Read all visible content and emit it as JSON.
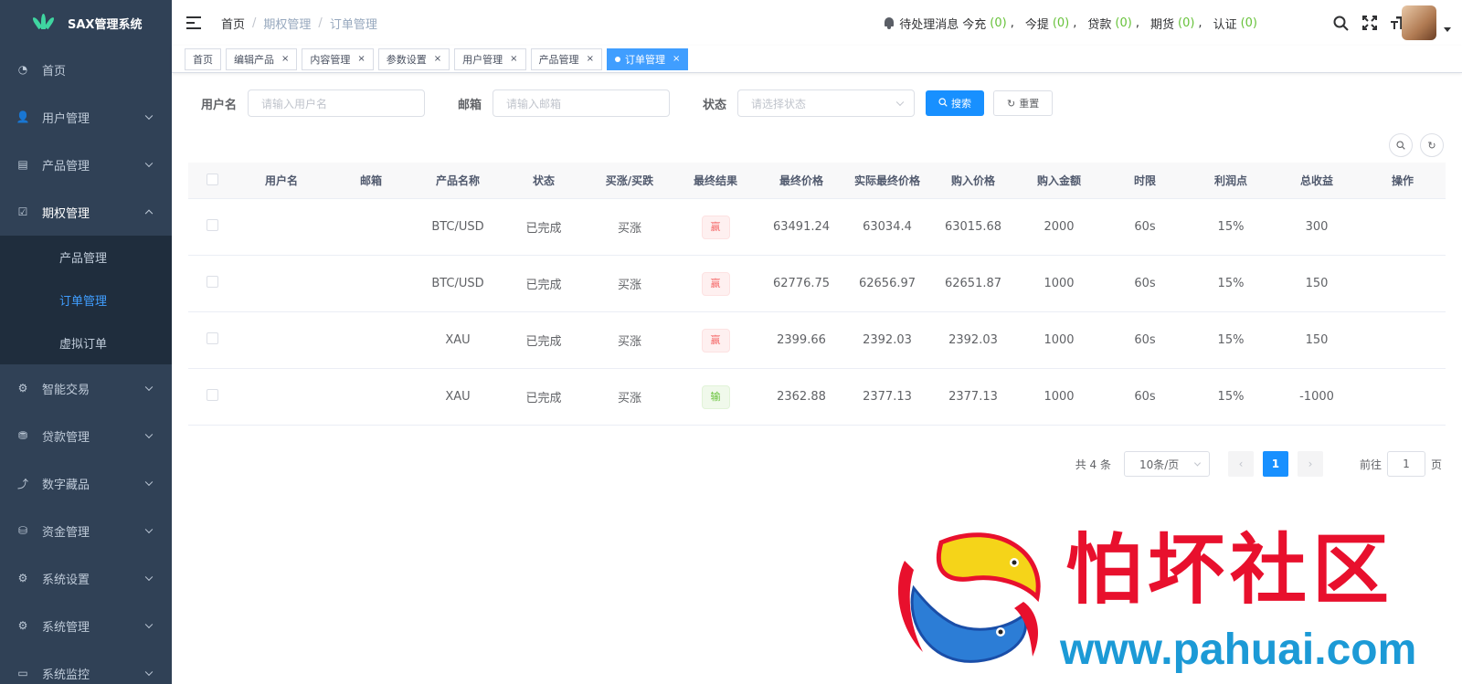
{
  "app": {
    "title": "SAX管理系统"
  },
  "sidebar": {
    "items": [
      {
        "label": "首页",
        "icon": "dashboard-icon"
      },
      {
        "label": "用户管理",
        "icon": "user-icon"
      },
      {
        "label": "产品管理",
        "icon": "document-icon"
      },
      {
        "label": "期权管理",
        "icon": "checkbox-icon"
      },
      {
        "label": "智能交易",
        "icon": "gear-icon"
      },
      {
        "label": "贷款管理",
        "icon": "stack-icon"
      },
      {
        "label": "数字藏品",
        "icon": "chart-icon"
      },
      {
        "label": "资金管理",
        "icon": "money-icon"
      },
      {
        "label": "系统设置",
        "icon": "gear-icon"
      },
      {
        "label": "系统管理",
        "icon": "gear-icon"
      },
      {
        "label": "系统监控",
        "icon": "monitor-icon"
      }
    ],
    "submenu": [
      {
        "label": "产品管理"
      },
      {
        "label": "订单管理"
      },
      {
        "label": "虚拟订单"
      }
    ]
  },
  "header": {
    "breadcrumb": [
      "首页",
      "期权管理",
      "订单管理"
    ],
    "notify": {
      "label": "待处理消息",
      "items": [
        {
          "label": "今充",
          "count": "(0)"
        },
        {
          "label": "今提",
          "count": "(0)"
        },
        {
          "label": "贷款",
          "count": "(0)"
        },
        {
          "label": "期货",
          "count": "(0)"
        },
        {
          "label": "认证",
          "count": "(0)"
        }
      ]
    }
  },
  "tags": [
    "首页",
    "编辑产品",
    "内容管理",
    "参数设置",
    "用户管理",
    "产品管理",
    "订单管理"
  ],
  "search": {
    "username_label": "用户名",
    "username_placeholder": "请输入用户名",
    "email_label": "邮箱",
    "email_placeholder": "请输入邮箱",
    "status_label": "状态",
    "status_placeholder": "请选择状态",
    "search_btn": "搜索",
    "reset_btn": "重置"
  },
  "table": {
    "columns": [
      "用户名",
      "邮箱",
      "产品名称",
      "状态",
      "买涨/买跌",
      "最终结果",
      "最终价格",
      "实际最终价格",
      "购入价格",
      "购入金额",
      "时限",
      "利润点",
      "总收益",
      "操作"
    ],
    "rows": [
      {
        "username": "",
        "email": "",
        "product": "BTC/USD",
        "status": "已完成",
        "direction": "买涨",
        "result": "赢",
        "result_type": "win",
        "final_price": "63491.24",
        "actual_final_price": "63034.4",
        "buy_price": "63015.68",
        "amount": "2000",
        "period": "60s",
        "profit_rate": "15%",
        "total_profit": "300"
      },
      {
        "username": "",
        "email": "",
        "product": "BTC/USD",
        "status": "已完成",
        "direction": "买涨",
        "result": "赢",
        "result_type": "win",
        "final_price": "62776.75",
        "actual_final_price": "62656.97",
        "buy_price": "62651.87",
        "amount": "1000",
        "period": "60s",
        "profit_rate": "15%",
        "total_profit": "150"
      },
      {
        "username": "",
        "email": "",
        "product": "XAU",
        "status": "已完成",
        "direction": "买涨",
        "result": "赢",
        "result_type": "win",
        "final_price": "2399.66",
        "actual_final_price": "2392.03",
        "buy_price": "2392.03",
        "amount": "1000",
        "period": "60s",
        "profit_rate": "15%",
        "total_profit": "150"
      },
      {
        "username": "",
        "email": "",
        "product": "XAU",
        "status": "已完成",
        "direction": "买涨",
        "result": "输",
        "result_type": "lose",
        "final_price": "2362.88",
        "actual_final_price": "2377.13",
        "buy_price": "2377.13",
        "amount": "1000",
        "period": "60s",
        "profit_rate": "15%",
        "total_profit": "-1000"
      }
    ]
  },
  "pagination": {
    "total": "共 4 条",
    "page_size": "10条/页",
    "current_page": "1",
    "goto_label": "前往",
    "goto_value": "1",
    "page_suffix": "页"
  },
  "watermark": {
    "title": "怕坏社区",
    "url": "www.pahuai.com"
  },
  "colors": {
    "sidebar_bg": "#304156",
    "submenu_bg": "#1f2d3d",
    "accent": "#409eff",
    "primary_btn": "#1890ff",
    "win": "#f56c6c",
    "lose": "#67c23a"
  }
}
